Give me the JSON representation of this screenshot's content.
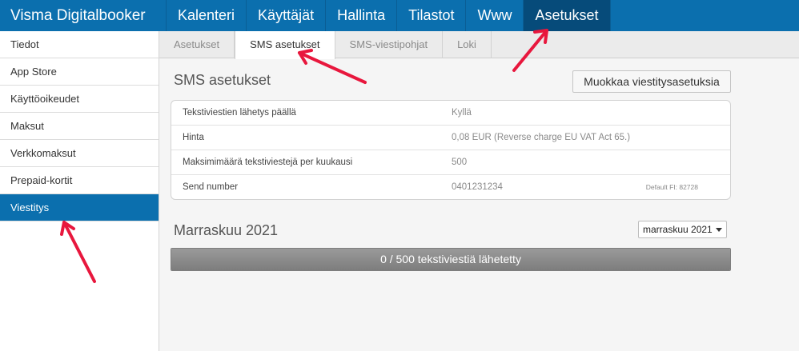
{
  "app": {
    "title": "Visma Digitalbooker"
  },
  "topnav": {
    "items": [
      "Kalenteri",
      "Käyttäjät",
      "Hallinta",
      "Tilastot",
      "Www",
      "Asetukset"
    ],
    "active": "Asetukset"
  },
  "sidebar": {
    "items": [
      "Tiedot",
      "App Store",
      "Käyttöoikeudet",
      "Maksut",
      "Verkkomaksut",
      "Prepaid-kortit",
      "Viestitys"
    ],
    "active": "Viestitys"
  },
  "tabs": {
    "items": [
      "Asetukset",
      "SMS asetukset",
      "SMS-viestipohjat",
      "Loki"
    ],
    "active": "SMS asetukset"
  },
  "sms": {
    "title": "SMS asetukset",
    "edit_button": "Muokkaa viestitysasetuksia",
    "rows": [
      {
        "label": "Tekstiviestien lähetys päällä",
        "value": "Kyllä",
        "note": ""
      },
      {
        "label": "Hinta",
        "value": "0,08 EUR (Reverse charge EU VAT Act 65.)",
        "note": ""
      },
      {
        "label": "Maksimimäärä tekstiviestejä per kuukausi",
        "value": "500",
        "note": ""
      },
      {
        "label": "Send number",
        "value": "0401231234",
        "note": "Default FI: 82728"
      }
    ]
  },
  "month": {
    "title": "Marraskuu 2021",
    "selected": "marraskuu 2021"
  },
  "usage": {
    "sent": 0,
    "limit": 500,
    "label": "0 / 500 tekstiviestiä lähetetty",
    "fraction": 0.0
  },
  "colors": {
    "brand": "#0b6fae",
    "active_nav": "#064b7a",
    "arrow": "#e8173d"
  }
}
